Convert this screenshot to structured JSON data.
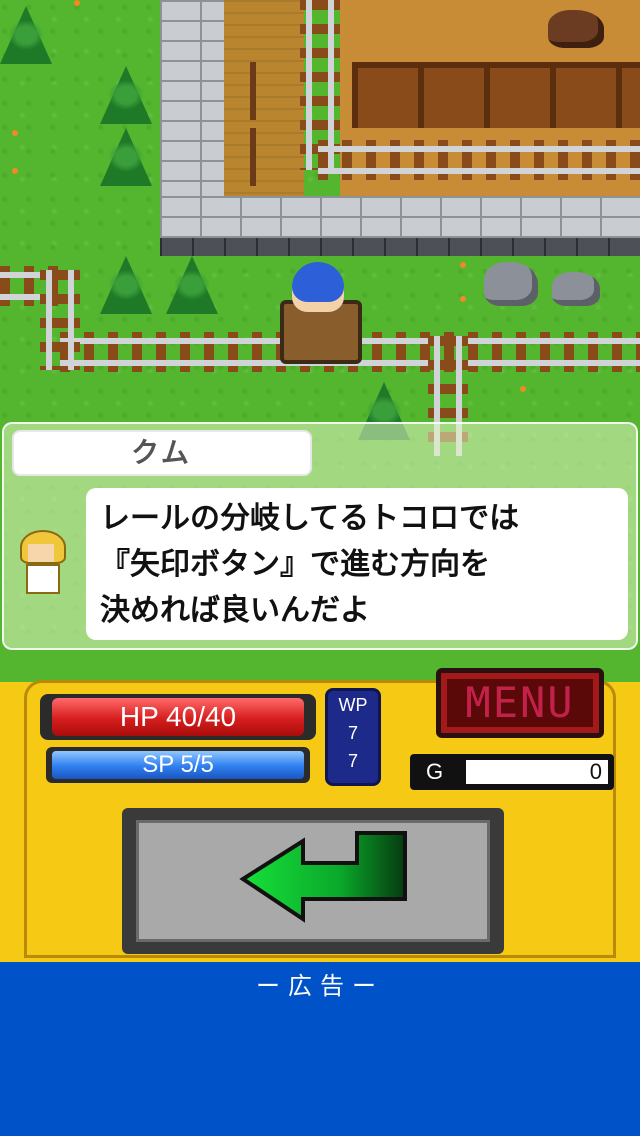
{
  "dialog": {
    "speaker": "クム",
    "lines": [
      "レールの分岐してるトコロでは",
      "『矢印ボタン』で進む方向を",
      "決めれば良いんだよ"
    ]
  },
  "status": {
    "hp_label": "HP 40/40",
    "sp_label": "SP 5/5",
    "hp_fraction": 1.0,
    "sp_fraction": 1.0,
    "wp_label": "WP",
    "wp_value_1": "7",
    "wp_value_2": "7",
    "gold_label": "G",
    "gold_value": "0"
  },
  "buttons": {
    "menu_label": "MENU",
    "arrow_direction": "left"
  },
  "ad": {
    "label": "ー広告ー"
  },
  "colors": {
    "hud_yellow": "#f6c915",
    "ad_blue": "#0052c8",
    "grass": "#54b52e"
  }
}
